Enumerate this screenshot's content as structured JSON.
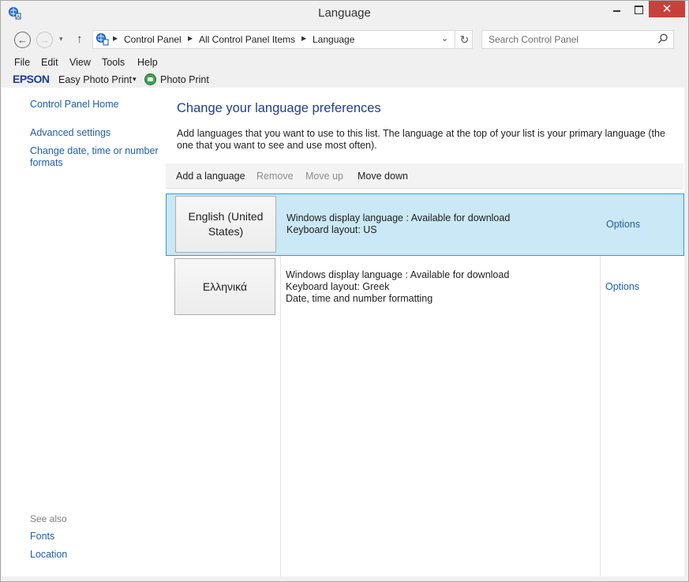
{
  "window": {
    "title": "Language",
    "close_glyph": "✕"
  },
  "nav": {
    "back_glyph": "←",
    "forward_glyph": "→",
    "recent_glyph": "▾",
    "up_glyph": "↑",
    "breadcrumbs": [
      "Control Panel",
      "All Control Panel Items",
      "Language"
    ],
    "separator_glyph": "▶",
    "dropdown_glyph": "⌄",
    "refresh_glyph": "↻",
    "search_placeholder": "Search Control Panel"
  },
  "menu": {
    "items": [
      "File",
      "Edit",
      "View",
      "Tools",
      "Help"
    ]
  },
  "epson": {
    "logo": "EPSON",
    "easy_photo_print": "Easy Photo Print",
    "caret": "▾",
    "photo_print": "Photo Print"
  },
  "sidebar": {
    "home_link": "Control Panel Home",
    "advanced_link": "Advanced settings",
    "datetime_link": "Change date, time or number formats",
    "see_also_label": "See also",
    "fonts_link": "Fonts",
    "location_link": "Location"
  },
  "main": {
    "title": "Change your language preferences",
    "description": "Add languages that you want to use to this list. The language at the top of your list is your primary language (the one that you want to see and use most often).",
    "commands": {
      "add": "Add a language",
      "remove": "Remove",
      "move_up": "Move up",
      "move_down": "Move down"
    },
    "languages": [
      {
        "name": "English (United States)",
        "lines": [
          "Windows display language : Available for download",
          "Keyboard layout: US"
        ],
        "options": "Options",
        "selected": true
      },
      {
        "name": "Ελληνικά",
        "lines": [
          "Windows display language : Available for download",
          "Keyboard layout: Greek",
          "Date, time and number formatting"
        ],
        "options": "Options",
        "selected": false
      }
    ]
  },
  "colors": {
    "link": "#1e5ea8",
    "title": "#1e3f8c",
    "selection": "#cbe8f6",
    "selection_border": "#26a0da",
    "close_button": "#c7413b",
    "epson_brand": "#1d3c8f"
  }
}
